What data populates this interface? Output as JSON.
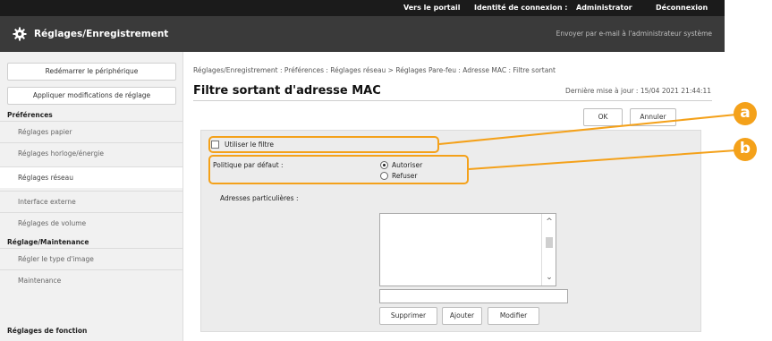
{
  "topbar": {
    "portal_link": "Vers le portail",
    "login_label": "Identité de connexion :",
    "user": "Administrator",
    "logout": "Déconnexion"
  },
  "header": {
    "title": "Réglages/Enregistrement",
    "email_admin": "Envoyer par e-mail à l'administrateur système"
  },
  "sidebar": {
    "restart_button": "Redémarrer le périphérique",
    "apply_button": "Appliquer modifications de réglage",
    "section_preferences": "Préférences",
    "items": [
      "Réglages papier",
      "Réglages horloge/énergie",
      "Réglages réseau",
      "Interface externe",
      "Réglages de volume"
    ],
    "section_maintenance": "Réglage/Maintenance",
    "maintenance_items": [
      "Régler le type d'image",
      "Maintenance"
    ],
    "section_function": "Réglages de fonction"
  },
  "main": {
    "breadcrumb": "Réglages/Enregistrement : Préférences : Réglages réseau > Réglages Pare-feu : Adresse MAC : Filtre sortant",
    "title": "Filtre sortant d'adresse MAC",
    "last_update": "Dernière mise à jour : 15/04 2021 21:44:11",
    "ok": "OK",
    "cancel": "Annuler",
    "use_filter": "Utiliser le filtre",
    "policy_label": "Politique par défaut :",
    "allow": "Autoriser",
    "deny": "Refuser",
    "addresses_label": "Adresses particulières :",
    "delete": "Supprimer",
    "add": "Ajouter",
    "edit": "Modifier"
  },
  "callouts": {
    "a": "a",
    "b": "b",
    "color": "#f4a11a"
  },
  "state": {
    "use_filter_checked": false,
    "policy_selected": "Autoriser"
  }
}
